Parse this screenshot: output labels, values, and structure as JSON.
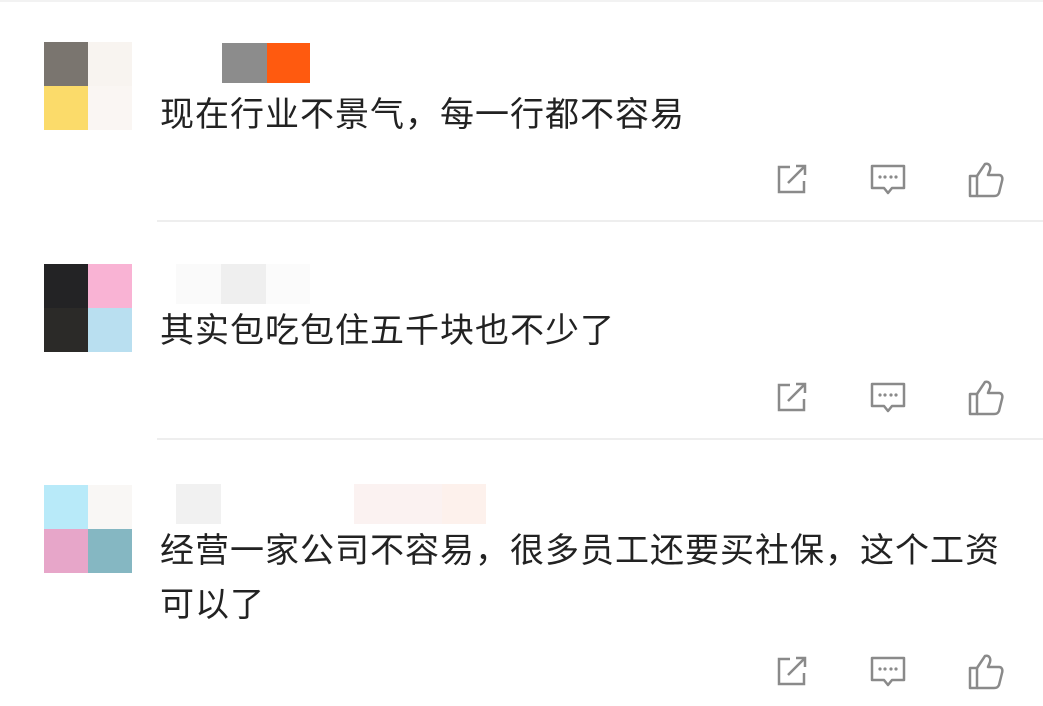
{
  "comments": [
    {
      "text": "现在行业不景气，每一行都不容易",
      "avatar_colors": [
        "#7a756f",
        "#f8f4f0",
        "#fbdb6a",
        "#faf6f3"
      ],
      "username_colors": [
        "#8c8c8c",
        "#ff5a0f"
      ]
    },
    {
      "text": "其实包吃包住五千块也不少了",
      "avatar_colors": [
        "#232325",
        "#f9b3d4",
        "#2b2a28",
        "#b9dff0"
      ],
      "username_colors": [
        "#fafafa",
        "#efefef",
        "#fbfbfb"
      ]
    },
    {
      "text": "经营一家公司不容易，很多员工还要买社保，这个工资可以了",
      "avatar_colors": [
        "#b8eaf9",
        "#f9f7f5",
        "#e7a6c9",
        "#85b7c2"
      ],
      "username_colors": [
        "#f1f1f1",
        "#fbf2f1",
        "#fdf1ec"
      ]
    }
  ],
  "icons": {
    "share": "share-icon",
    "comment": "comment-icon",
    "like": "thumbs-up-icon"
  },
  "colors": {
    "text": "#222222",
    "icon": "#8a8a8a",
    "divider": "#eeeeee"
  }
}
